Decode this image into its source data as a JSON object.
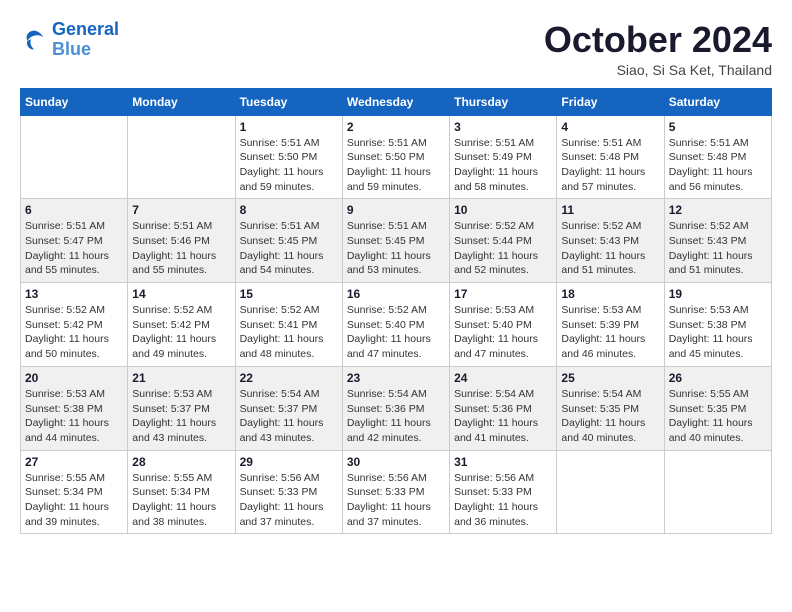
{
  "header": {
    "logo_line1": "General",
    "logo_line2": "Blue",
    "month": "October 2024",
    "location": "Siao, Si Sa Ket, Thailand"
  },
  "weekdays": [
    "Sunday",
    "Monday",
    "Tuesday",
    "Wednesday",
    "Thursday",
    "Friday",
    "Saturday"
  ],
  "weeks": [
    [
      {
        "day": "",
        "info": ""
      },
      {
        "day": "",
        "info": ""
      },
      {
        "day": "1",
        "info": "Sunrise: 5:51 AM\nSunset: 5:50 PM\nDaylight: 11 hours\nand 59 minutes."
      },
      {
        "day": "2",
        "info": "Sunrise: 5:51 AM\nSunset: 5:50 PM\nDaylight: 11 hours\nand 59 minutes."
      },
      {
        "day": "3",
        "info": "Sunrise: 5:51 AM\nSunset: 5:49 PM\nDaylight: 11 hours\nand 58 minutes."
      },
      {
        "day": "4",
        "info": "Sunrise: 5:51 AM\nSunset: 5:48 PM\nDaylight: 11 hours\nand 57 minutes."
      },
      {
        "day": "5",
        "info": "Sunrise: 5:51 AM\nSunset: 5:48 PM\nDaylight: 11 hours\nand 56 minutes."
      }
    ],
    [
      {
        "day": "6",
        "info": "Sunrise: 5:51 AM\nSunset: 5:47 PM\nDaylight: 11 hours\nand 55 minutes."
      },
      {
        "day": "7",
        "info": "Sunrise: 5:51 AM\nSunset: 5:46 PM\nDaylight: 11 hours\nand 55 minutes."
      },
      {
        "day": "8",
        "info": "Sunrise: 5:51 AM\nSunset: 5:45 PM\nDaylight: 11 hours\nand 54 minutes."
      },
      {
        "day": "9",
        "info": "Sunrise: 5:51 AM\nSunset: 5:45 PM\nDaylight: 11 hours\nand 53 minutes."
      },
      {
        "day": "10",
        "info": "Sunrise: 5:52 AM\nSunset: 5:44 PM\nDaylight: 11 hours\nand 52 minutes."
      },
      {
        "day": "11",
        "info": "Sunrise: 5:52 AM\nSunset: 5:43 PM\nDaylight: 11 hours\nand 51 minutes."
      },
      {
        "day": "12",
        "info": "Sunrise: 5:52 AM\nSunset: 5:43 PM\nDaylight: 11 hours\nand 51 minutes."
      }
    ],
    [
      {
        "day": "13",
        "info": "Sunrise: 5:52 AM\nSunset: 5:42 PM\nDaylight: 11 hours\nand 50 minutes."
      },
      {
        "day": "14",
        "info": "Sunrise: 5:52 AM\nSunset: 5:42 PM\nDaylight: 11 hours\nand 49 minutes."
      },
      {
        "day": "15",
        "info": "Sunrise: 5:52 AM\nSunset: 5:41 PM\nDaylight: 11 hours\nand 48 minutes."
      },
      {
        "day": "16",
        "info": "Sunrise: 5:52 AM\nSunset: 5:40 PM\nDaylight: 11 hours\nand 47 minutes."
      },
      {
        "day": "17",
        "info": "Sunrise: 5:53 AM\nSunset: 5:40 PM\nDaylight: 11 hours\nand 47 minutes."
      },
      {
        "day": "18",
        "info": "Sunrise: 5:53 AM\nSunset: 5:39 PM\nDaylight: 11 hours\nand 46 minutes."
      },
      {
        "day": "19",
        "info": "Sunrise: 5:53 AM\nSunset: 5:38 PM\nDaylight: 11 hours\nand 45 minutes."
      }
    ],
    [
      {
        "day": "20",
        "info": "Sunrise: 5:53 AM\nSunset: 5:38 PM\nDaylight: 11 hours\nand 44 minutes."
      },
      {
        "day": "21",
        "info": "Sunrise: 5:53 AM\nSunset: 5:37 PM\nDaylight: 11 hours\nand 43 minutes."
      },
      {
        "day": "22",
        "info": "Sunrise: 5:54 AM\nSunset: 5:37 PM\nDaylight: 11 hours\nand 43 minutes."
      },
      {
        "day": "23",
        "info": "Sunrise: 5:54 AM\nSunset: 5:36 PM\nDaylight: 11 hours\nand 42 minutes."
      },
      {
        "day": "24",
        "info": "Sunrise: 5:54 AM\nSunset: 5:36 PM\nDaylight: 11 hours\nand 41 minutes."
      },
      {
        "day": "25",
        "info": "Sunrise: 5:54 AM\nSunset: 5:35 PM\nDaylight: 11 hours\nand 40 minutes."
      },
      {
        "day": "26",
        "info": "Sunrise: 5:55 AM\nSunset: 5:35 PM\nDaylight: 11 hours\nand 40 minutes."
      }
    ],
    [
      {
        "day": "27",
        "info": "Sunrise: 5:55 AM\nSunset: 5:34 PM\nDaylight: 11 hours\nand 39 minutes."
      },
      {
        "day": "28",
        "info": "Sunrise: 5:55 AM\nSunset: 5:34 PM\nDaylight: 11 hours\nand 38 minutes."
      },
      {
        "day": "29",
        "info": "Sunrise: 5:56 AM\nSunset: 5:33 PM\nDaylight: 11 hours\nand 37 minutes."
      },
      {
        "day": "30",
        "info": "Sunrise: 5:56 AM\nSunset: 5:33 PM\nDaylight: 11 hours\nand 37 minutes."
      },
      {
        "day": "31",
        "info": "Sunrise: 5:56 AM\nSunset: 5:33 PM\nDaylight: 11 hours\nand 36 minutes."
      },
      {
        "day": "",
        "info": ""
      },
      {
        "day": "",
        "info": ""
      }
    ]
  ]
}
